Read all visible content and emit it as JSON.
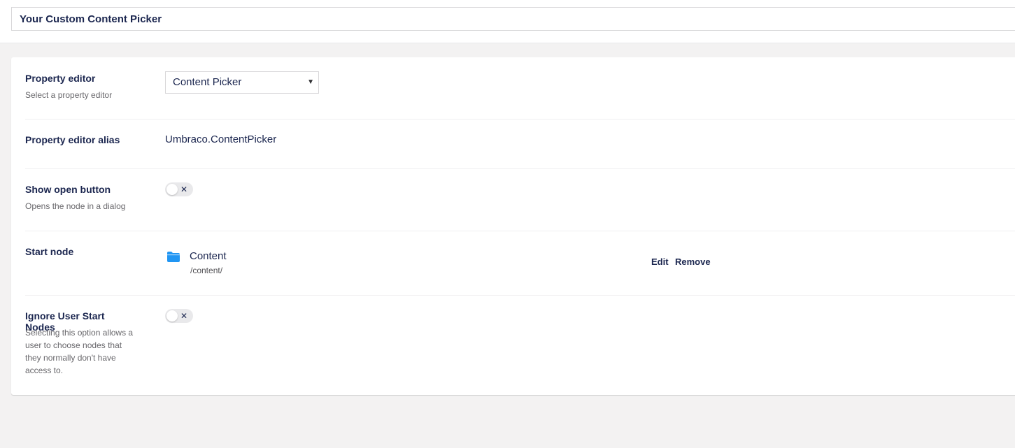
{
  "header": {
    "name_value": "Your Custom Content Picker"
  },
  "fields": {
    "property_editor": {
      "label": "Property editor",
      "description": "Select a property editor",
      "selected": "Content Picker"
    },
    "alias": {
      "label": "Property editor alias",
      "value": "Umbraco.ContentPicker"
    },
    "show_open_button": {
      "label": "Show open button",
      "description": "Opens the node in a dialog",
      "toggle_state": "off",
      "toggle_glyph": "✕"
    },
    "start_node": {
      "label": "Start node",
      "node_icon": "folder-icon",
      "node_name": "Content",
      "node_path": "/content/",
      "edit_label": "Edit",
      "remove_label": "Remove"
    },
    "ignore_user_start_nodes": {
      "label": "Ignore User Start Nodes",
      "description_lines": [
        "Selecting this option allows a",
        "user to choose nodes that",
        "they normally don't have",
        "access to."
      ],
      "toggle_state": "off",
      "toggle_glyph": "✕"
    }
  },
  "colors": {
    "text_primary": "#1b264f",
    "folder_icon": "#2196f3",
    "background": "#f3f2f2"
  }
}
